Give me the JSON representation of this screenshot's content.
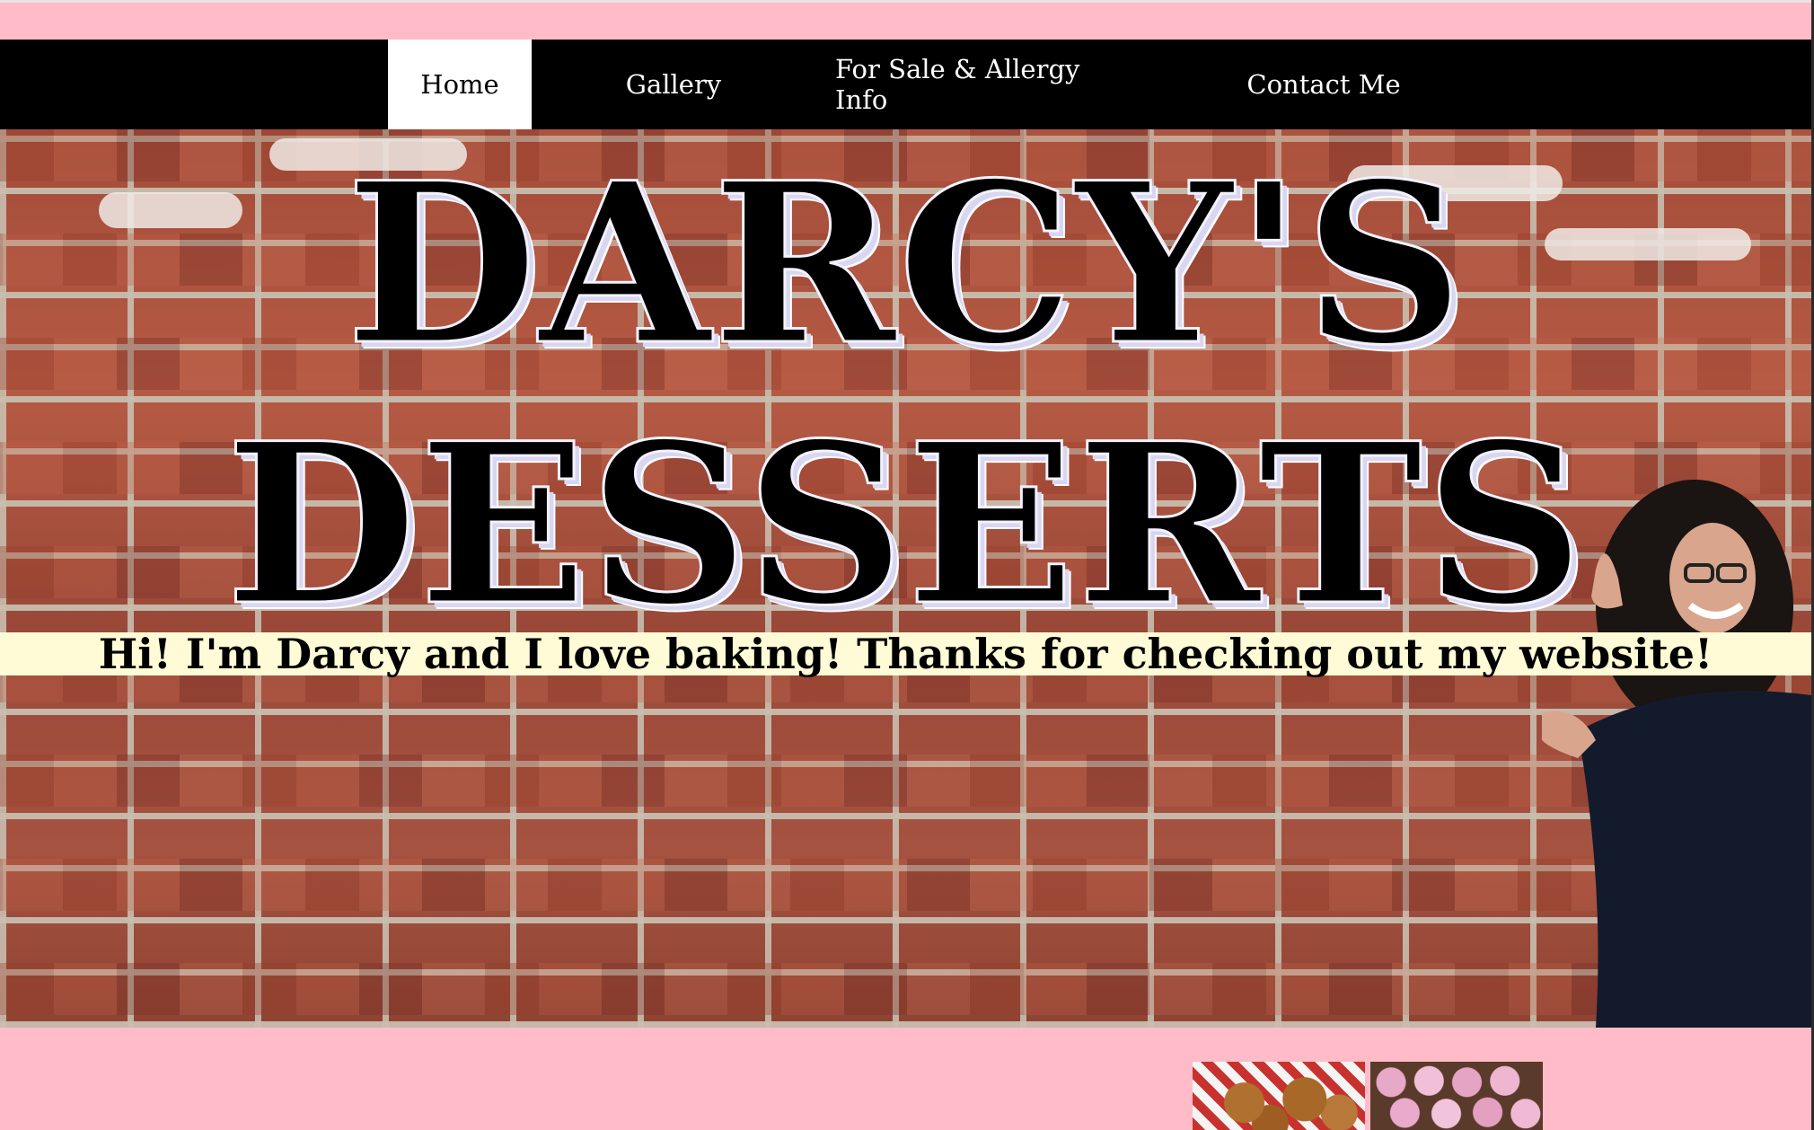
{
  "nav": {
    "items": [
      {
        "label": "Home",
        "active": true
      },
      {
        "label": "Gallery",
        "active": false
      },
      {
        "label": "For Sale & Allergy Info",
        "active": false
      },
      {
        "label": "Contact Me",
        "active": false
      }
    ]
  },
  "hero": {
    "title_line1": "DARCY'S",
    "title_line2": "DESSERTS",
    "tagline": "Hi! I'm Darcy and I love baking! Thanks for checking out my website!"
  },
  "colors": {
    "page_background": "#FFBCC8",
    "navbar": "#000000",
    "tagline_bar": "#FFFBD6"
  },
  "gallery_preview": [
    {
      "name": "cookies-thumbnail"
    },
    {
      "name": "cupcakes-thumbnail"
    }
  ]
}
